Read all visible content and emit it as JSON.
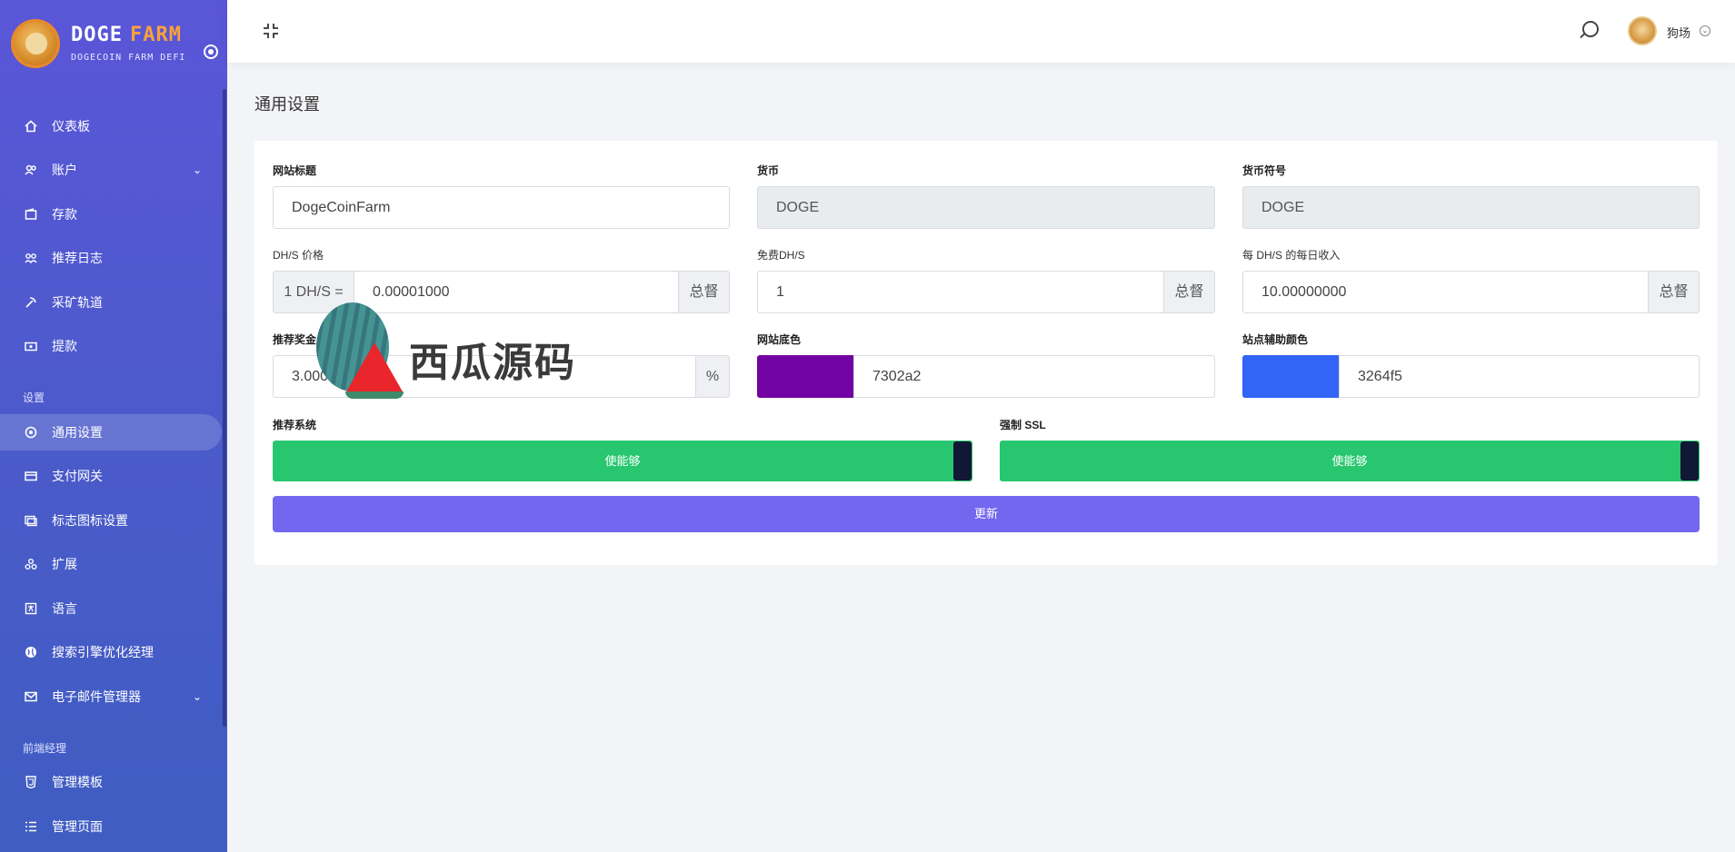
{
  "brand": {
    "word1": "DOGE",
    "word2": "FARM",
    "subtitle": "DOGECOIN FARM DEFI"
  },
  "sidebar": {
    "items": [
      {
        "label": "仪表板",
        "icon": "home-icon"
      },
      {
        "label": "账户",
        "icon": "users-icon",
        "has_children": true
      },
      {
        "label": "存款",
        "icon": "wallet-icon"
      },
      {
        "label": "推荐日志",
        "icon": "referral-icon"
      },
      {
        "label": "采矿轨道",
        "icon": "mining-icon"
      },
      {
        "label": "提款",
        "icon": "withdraw-icon"
      }
    ],
    "heading_settings": "设置",
    "settings_items": [
      {
        "label": "通用设置",
        "icon": "settings-icon",
        "active": true
      },
      {
        "label": "支付网关",
        "icon": "card-icon"
      },
      {
        "label": "标志图标设置",
        "icon": "image-icon"
      },
      {
        "label": "扩展",
        "icon": "extension-icon"
      },
      {
        "label": "语言",
        "icon": "language-icon"
      },
      {
        "label": "搜索引擎优化经理",
        "icon": "globe-icon"
      },
      {
        "label": "电子邮件管理器",
        "icon": "mail-icon",
        "has_children": true
      }
    ],
    "heading_frontend": "前端经理",
    "frontend_items": [
      {
        "label": "管理模板",
        "icon": "html5-icon"
      },
      {
        "label": "管理页面",
        "icon": "list-icon"
      }
    ]
  },
  "topbar": {
    "user_name": "狗场"
  },
  "page": {
    "title": "通用设置"
  },
  "form": {
    "site_title": {
      "label": "网站标题",
      "value": "DogeCoinFarm"
    },
    "currency": {
      "label": "货币",
      "value": "DOGE"
    },
    "currency_symbol": {
      "label": "货币符号",
      "value": "DOGE"
    },
    "dhs_price": {
      "label": "DH/S 价格",
      "prefix": "1 DH/S =",
      "value": "0.00001000",
      "suffix": "总督"
    },
    "free_dhs": {
      "label": "免费DH/S",
      "value": "1",
      "suffix": "总督"
    },
    "daily_income": {
      "label": "每 DH/S 的每日收入",
      "value": "10.00000000",
      "suffix": "总督"
    },
    "referral_bonus": {
      "label": "推荐奖金",
      "value": "3.000",
      "suffix": "%"
    },
    "base_color": {
      "label": "网站底色",
      "value": "7302a2",
      "swatch": "#7302a2"
    },
    "secondary_color": {
      "label": "站点辅助颜色",
      "value": "3264f5",
      "swatch": "#3264f5"
    },
    "referral_system": {
      "label": "推荐系统",
      "state": "使能够"
    },
    "force_ssl": {
      "label": "强制 SSL",
      "state": "使能够"
    },
    "update_label": "更新"
  },
  "watermark": {
    "text": "西瓜源码"
  },
  "colors": {
    "primary": "#7367f0",
    "success": "#28c76f",
    "sidebar": "#5a56d8"
  }
}
